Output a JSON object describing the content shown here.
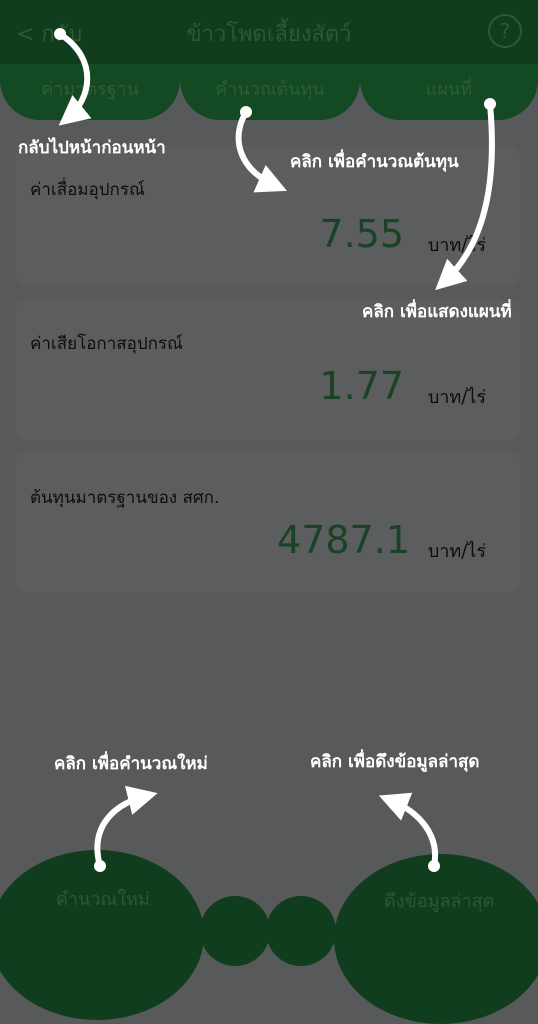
{
  "header": {
    "back_label": "< กลับ",
    "title": "ข้าวโพดเลี้ยงสัตว์",
    "help_label": "?"
  },
  "tabs": [
    {
      "label": "ค่ามาตรฐาน"
    },
    {
      "label": "คำนวณต้นทุน"
    },
    {
      "label": "แผนที่"
    }
  ],
  "cards": [
    {
      "label": "ค่าเสื่อมอุปกรณ์",
      "value": "7.55",
      "unit": "บาท/ไร่"
    },
    {
      "label": "ค่าเสียโอกาสอุปกรณ์",
      "value": "1.77",
      "unit": "บาท/ไร่"
    },
    {
      "label": "ต้นทุนมาตรฐานของ สศก.",
      "value": "4787.1",
      "unit": "บาท/ไร่"
    }
  ],
  "footer": {
    "recalc_label": "คำนวณใหม่",
    "refresh_label": "ดึงข้อมูลล่าสุด"
  },
  "annotations": {
    "back_hint": "กลับไปหน้าก่อนหน้า",
    "calc_hint": "คลิก  เพื่อคำนวณต้นทุน",
    "map_hint": "คลิก  เพื่อแสดงแผนที่",
    "recalc_hint": "คลิก  เพื่อคำนวณใหม่",
    "refresh_hint": "คลิก  เพื่อดึงข้อมูลล่าสุด"
  },
  "colors": {
    "overlay_background": "#58595b",
    "header_green": "#0f3d1d",
    "value_green": "#1a4224"
  }
}
